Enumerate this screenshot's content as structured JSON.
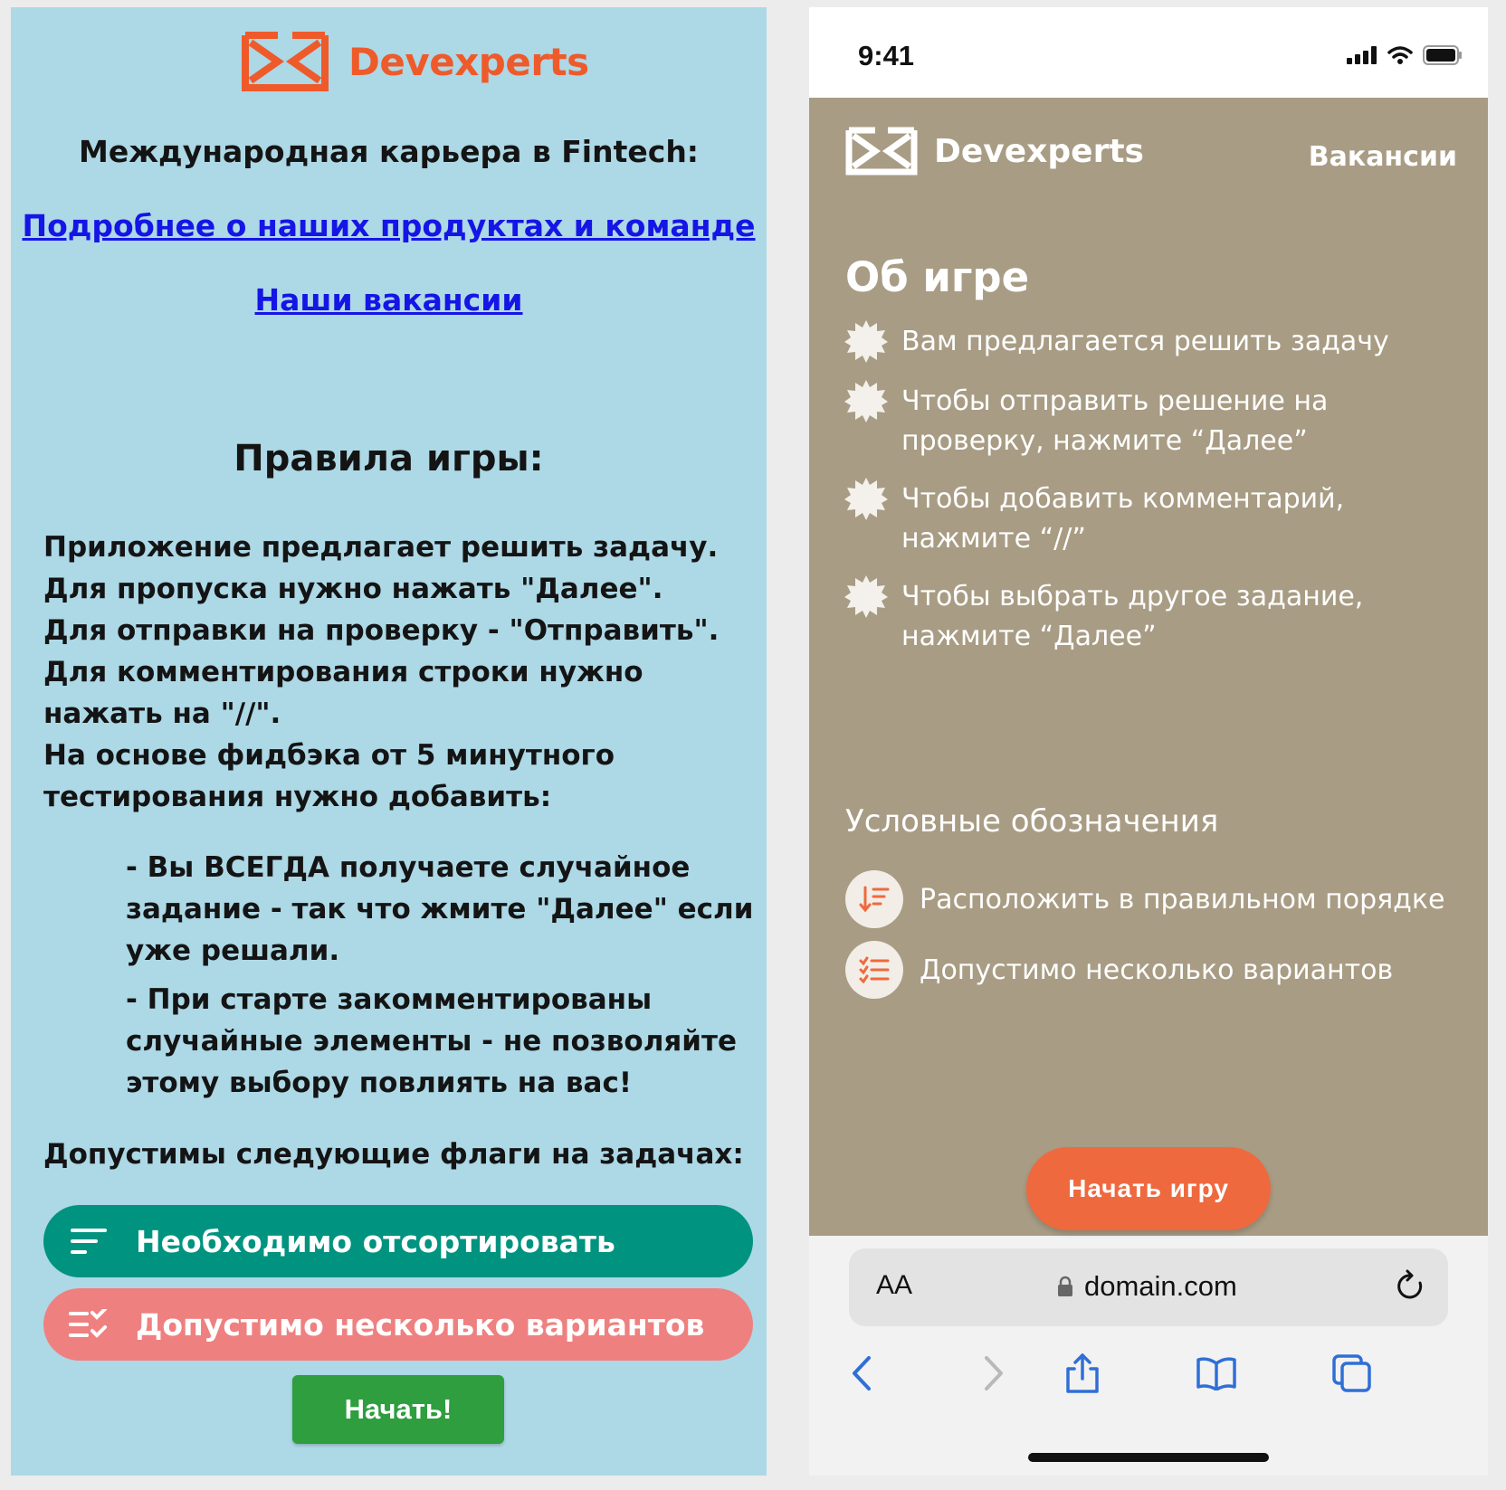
{
  "left": {
    "brand": "Devexperts",
    "career_heading": "Международная карьера в Fintech:",
    "link_products": "Подробнее о наших продуктах и команде",
    "link_vacancies": "Наши вакансии",
    "rules_heading": "Правила игры:",
    "rules_lines": [
      "Приложение предлагает решить задачу.",
      "Для пропуска нужно нажать \"Далее\".",
      "Для отправки на проверку - \"Отправить\".",
      "Для комментирования строки нужно",
      "нажать на \"//\".",
      "На основе фидбэка от 5 минутного",
      "тестирования нужно добавить:"
    ],
    "notes": [
      "- Вы ВСЕГДА получаете случайное задание - так что жмите \"Далее\" если уже решали.",
      "- При старте закомментированы случайные элементы - не позволяйте этому выбору повлиять на вас!"
    ],
    "flags_heading": "Допустимы следующие флаги на задачах:",
    "flag_sort": "Необходимо отсортировать",
    "flag_multi": "Допустимо несколько вариантов",
    "start_button": "Начать!"
  },
  "right": {
    "time": "9:41",
    "brand": "Devexperts",
    "vacancies": "Вакансии",
    "about_title": "Об игре",
    "bullets": [
      "Вам предлагается решить задачу",
      "Чтобы отправить решение на проверку, нажмите “Далее”",
      "Чтобы добавить комментарий, нажмите “//”",
      "Чтобы выбрать другое задание, нажмите “Далее”"
    ],
    "legend_title": "Условные обозначения",
    "legend_order": "Расположить в правильном порядке",
    "legend_multi": "Допустимо несколько вариантов",
    "play_button": "Начать игру",
    "url_aa": "AA",
    "url": "domain.com"
  },
  "colors": {
    "brand_orange": "#ef5a2b",
    "left_bg": "#add8e6",
    "app_bg": "#a89c84",
    "flag_sort": "#00937f",
    "flag_multi": "#ef8080",
    "start_green": "#2e9e3e",
    "play_orange": "#ef693e",
    "link_blue": "#1515e6"
  },
  "icons": {
    "logo": "devexperts-logo-icon",
    "sort": "sort-lines-icon",
    "multi": "checklist-icon",
    "bullet": "starburst-icon",
    "legend_order": "sort-down-icon",
    "legend_multi": "list-check-icon",
    "toolbar": [
      "back-icon",
      "forward-icon",
      "share-icon",
      "bookmarks-icon",
      "tabs-icon"
    ]
  }
}
